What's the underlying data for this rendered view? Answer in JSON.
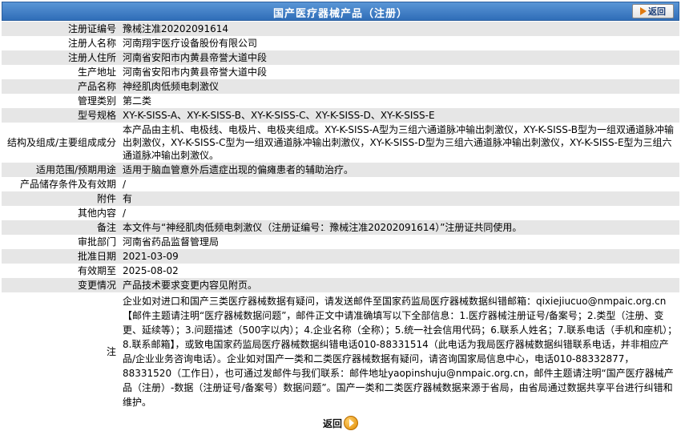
{
  "header": {
    "title": "国产医疗器械产品（注册）",
    "back_label": "返回"
  },
  "rows": [
    {
      "label": "注册证编号",
      "value": "豫械注准20202091614"
    },
    {
      "label": "注册人名称",
      "value": "河南翔宇医疗设备股份有限公司"
    },
    {
      "label": "注册人住所",
      "value": "河南省安阳市内黄县帝誉大道中段"
    },
    {
      "label": "生产地址",
      "value": "河南省安阳市内黄县帝誉大道中段"
    },
    {
      "label": "产品名称",
      "value": "神经肌肉低频电刺激仪"
    },
    {
      "label": "管理类别",
      "value": "第二类"
    },
    {
      "label": "型号规格",
      "value": "XY-K-SISS-A、XY-K-SISS-B、XY-K-SISS-C、XY-K-SISS-D、XY-K-SISS-E"
    },
    {
      "label": "结构及组成/主要组成成分",
      "value": "本产品由主机、电极线、电极片、电极夹组成。XY-K-SISS-A型为三组六通道脉冲输出刺激仪，XY-K-SISS-B型为一组双通道脉冲输出刺激仪，XY-K-SISS-C型为一组双通道脉冲输出刺激仪，XY-K-SISS-D型为三组六通道脉冲输出刺激仪，XY-K-SISS-E型为三组六通道脉冲输出刺激仪。"
    },
    {
      "label": "适用范围/预期用途",
      "value": "适用于脑血管意外后遗症出现的偏瘫患者的辅助治疗。"
    },
    {
      "label": "产品储存条件及有效期",
      "value": "/"
    },
    {
      "label": "附件",
      "value": "有"
    },
    {
      "label": "其他内容",
      "value": "/"
    },
    {
      "label": "备注",
      "value": "本文件与“神经肌肉低频电刺激仪（注册证编号：豫械注准20202091614）”注册证共同使用。"
    },
    {
      "label": "审批部门",
      "value": "河南省药品监督管理局"
    },
    {
      "label": "批准日期",
      "value": "2021-03-09"
    },
    {
      "label": "有效期至",
      "value": "2025-08-02"
    },
    {
      "label": "变更情况",
      "value": "产品技术要求变更内容见附页。"
    },
    {
      "label": "注",
      "value": "企业如对进口和国产三类医疗器械数据有疑问，请发送邮件至国家药监局医疗器械数据纠错邮箱：qixiejiucuo@nmpaic.org.cn【邮件主题请注明“医疗器械数据问题”，邮件正文中请准确填写以下全部信息：1.医疗器械注册证号/备案号；2.类型（注册、变更、延续等）；3.问题描述（500字以内）；4.企业名称（全称）；5.统一社会信用代码；6.联系人姓名；7.联系电话（手机和座机）；8.联系邮箱】，或致电国家药监局医疗器械数据纠错电话010-88331514（此电话为我局医疗器械数据纠错联系电话，并非相应产品/企业业务咨询电话）。企业如对国产一类和二类医疗器械数据有疑问，请咨询国家局信息中心，电话010-88332877，88331520（工作日），也可通过发邮件与我们联系：邮件地址yaopinshuju@nmpaic.org.cn，邮件主题请注明“国产医疗器械产品（注册）-数据（注册证号/备案号）数据问题”。国产一类和二类医疗器械数据来源于省局，由省局通过数据共享平台进行纠错和维护。"
    }
  ],
  "footer": {
    "back_label": "返回"
  }
}
